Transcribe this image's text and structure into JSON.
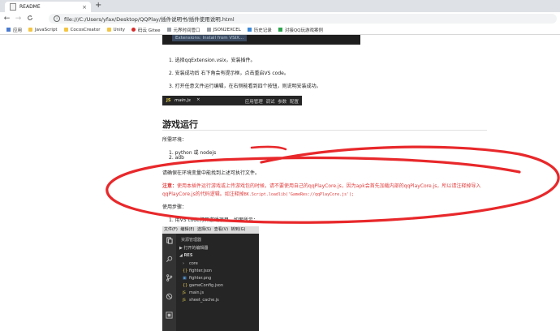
{
  "tab": {
    "title": "README",
    "close": "×",
    "new": "+"
  },
  "nav": {
    "back": "←",
    "forward": "→",
    "reload": "C"
  },
  "address": {
    "info": "i",
    "url": "file:///C:/Users/yfax/Desktop/QQPlay/插件说明书/插件使用说明.html"
  },
  "bookmarks": [
    "应用",
    "JavaScript",
    "CocosCreator",
    "Unity",
    "码云 Gitee",
    "元界时间管口",
    "JSON2EXCEL",
    "历史记录",
    "对接QQ玩游戏案例"
  ],
  "page": {
    "banner": "Extensions: Install from VSIX...",
    "steps": [
      "1. 选择qqExtension.vsix，安装插件。",
      "2. 安装成功后 右下角会有提示框，点击重启VS code。",
      "3. 打开任意文件运行编辑，在右侧能看到四个按钮，则说明安装成功。"
    ],
    "vsbar": {
      "js": "JS",
      "file": "main.js",
      "x": "×",
      "menu": "应用管理  调试  参数  配置"
    },
    "section_title": "游戏运行",
    "env_label": "所需环境：",
    "env_items": [
      "1. python 或 nodejs",
      "2. adb"
    ],
    "env_note": "请确保在环境变量中能找到上述可执行文件。",
    "warn_label": "注意：",
    "warn_line1": "使用本插件运行游戏或上传游戏包的时候，请不要使用自己的qqPlayCore.js，因为apk会首先加载内部的qqPlayCore.js，所以请注释掉导入",
    "warn_line2_a": "qqPlayCore.js的代码逻辑。如注释掉",
    "warn_code": "BK.Script.loadlib('GameRes://qqPlayCore.js');",
    "usage_label": "使用步骤：",
    "usage_1": "1. 用VS code打开游戏项目，如果所示："
  },
  "vscode": {
    "menu": [
      "文件(F)",
      "编辑(E)",
      "选择(S)",
      "查看(V)",
      "转到(G)"
    ],
    "explorer_title": "资源管理器",
    "open_editors": "▶ 打开的编辑器",
    "project": "◢ RES",
    "tree": [
      {
        "icon": "›",
        "name": "core"
      },
      {
        "icon": "{}",
        "name": "fighter.json"
      },
      {
        "icon": "▣",
        "name": "fighter.png"
      },
      {
        "icon": "{}",
        "name": "gameConfig.json"
      },
      {
        "icon": "JS",
        "name": "main.js"
      },
      {
        "icon": "JS",
        "name": "sheet_cache.js"
      }
    ]
  },
  "colors": {
    "annotation": "#e8282b",
    "warning": "#e23b3b",
    "editor_bg": "#252526"
  }
}
